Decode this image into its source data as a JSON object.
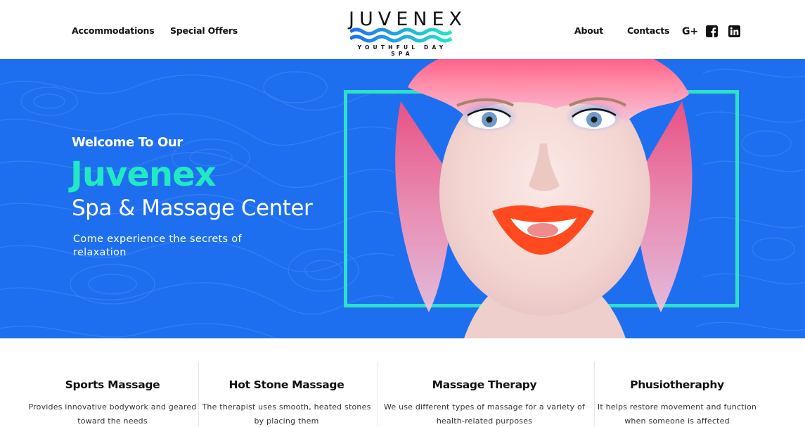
{
  "header": {
    "nav_left": [
      "Accommodations",
      "Special Offers"
    ],
    "nav_right": [
      "About",
      "Contacts"
    ],
    "logo": {
      "word": "JUVENEX",
      "subtitle": "YOUTHFUL DAY SPA"
    },
    "social": {
      "google_label": "G+",
      "icons": [
        "google-plus-icon",
        "facebook-icon",
        "linkedin-icon"
      ]
    }
  },
  "hero": {
    "welcome": "Welcome To Our",
    "brand": "Juvenex",
    "tagline": "Spa & Massage Center",
    "description": "Come experience the secrets of relaxation"
  },
  "services": [
    {
      "title": "Sports Massage",
      "text": "Provides innovative bodywork and geared toward the needs"
    },
    {
      "title": "Hot Stone Massage",
      "text": "The therapist uses smooth, heated stones by placing them"
    },
    {
      "title": "Massage Therapy",
      "text": "We use different types of massage for a variety of health-related purposes"
    },
    {
      "title": "Phusiotheraphy",
      "text": "It helps restore movement and function when someone is affected"
    }
  ],
  "colors": {
    "hero_blue": "#1e6fef",
    "accent_teal": "#22e8c4",
    "frame_teal": "#2fe0c8",
    "lips": "#ff4a1f",
    "hair_pink": "#ff6f8e"
  }
}
